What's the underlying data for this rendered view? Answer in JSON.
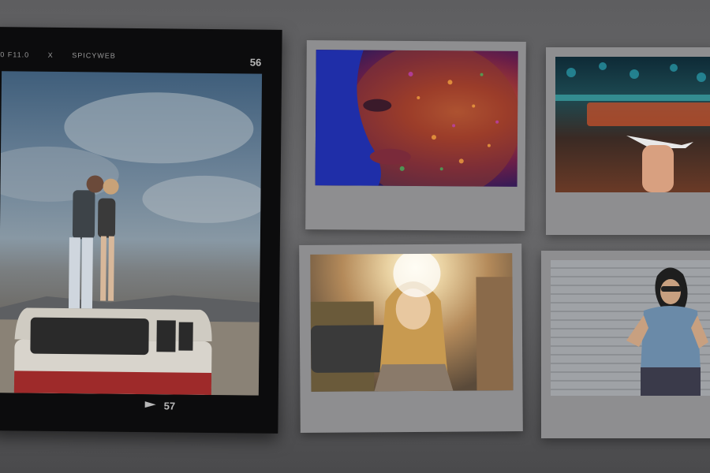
{
  "film": {
    "exposure": "0 F11.0",
    "separator": "X",
    "brand": "SPICYWEB",
    "frame_top": "56",
    "frame_bottom": "57"
  },
  "photos": [
    {
      "name": "couple-on-van",
      "description_icon": "photo-couple-van"
    },
    {
      "name": "face-with-colored-powder",
      "description_icon": "photo-powder-face"
    },
    {
      "name": "hand-holding-toy-plane",
      "description_icon": "photo-toy-plane"
    },
    {
      "name": "woman-in-sunlight",
      "description_icon": "photo-sunlit-woman"
    },
    {
      "name": "woman-with-sunglasses",
      "description_icon": "photo-woman-sunglasses"
    }
  ],
  "colors": {
    "overlay": "#000000",
    "film_black": "#0c0c0d",
    "polaroid_frame": "#8e8e90"
  }
}
